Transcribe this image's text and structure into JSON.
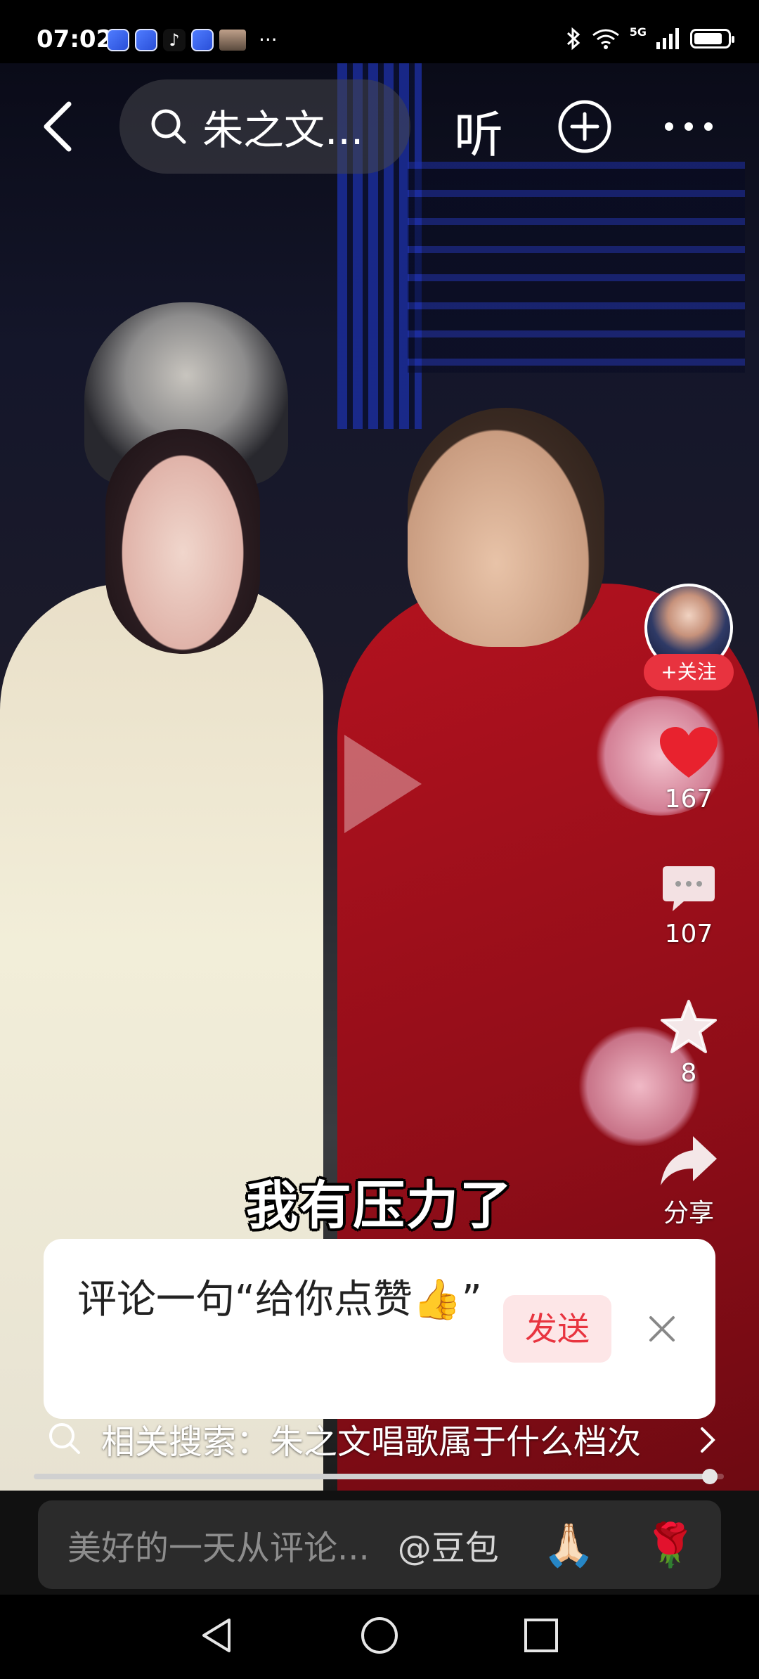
{
  "status_bar": {
    "time": "07:02",
    "more": "···",
    "network": "5G",
    "battery_level": 0.85
  },
  "top_nav": {
    "search_text": "朱之文...",
    "listen_label": "听"
  },
  "video": {
    "subtitle": "我有压力了"
  },
  "actions": {
    "follow_label": "+关注",
    "like_count": "167",
    "comment_count": "107",
    "favorite_count": "8",
    "share_label": "分享"
  },
  "comment_prompt": {
    "text": "评论一句“给你点赞👍”",
    "send_label": "发送"
  },
  "related_search": {
    "text": "相关搜索：朱之文唱歌属于什么档次"
  },
  "progress": {
    "fraction": 0.98
  },
  "comment_bar": {
    "placeholder": "美好的一天从评论...",
    "mention": "@豆包",
    "emoji_1": "🙏🏻",
    "emoji_2": "🌹"
  },
  "colors": {
    "accent_red": "#e8333f",
    "like_red": "#e8222e"
  }
}
